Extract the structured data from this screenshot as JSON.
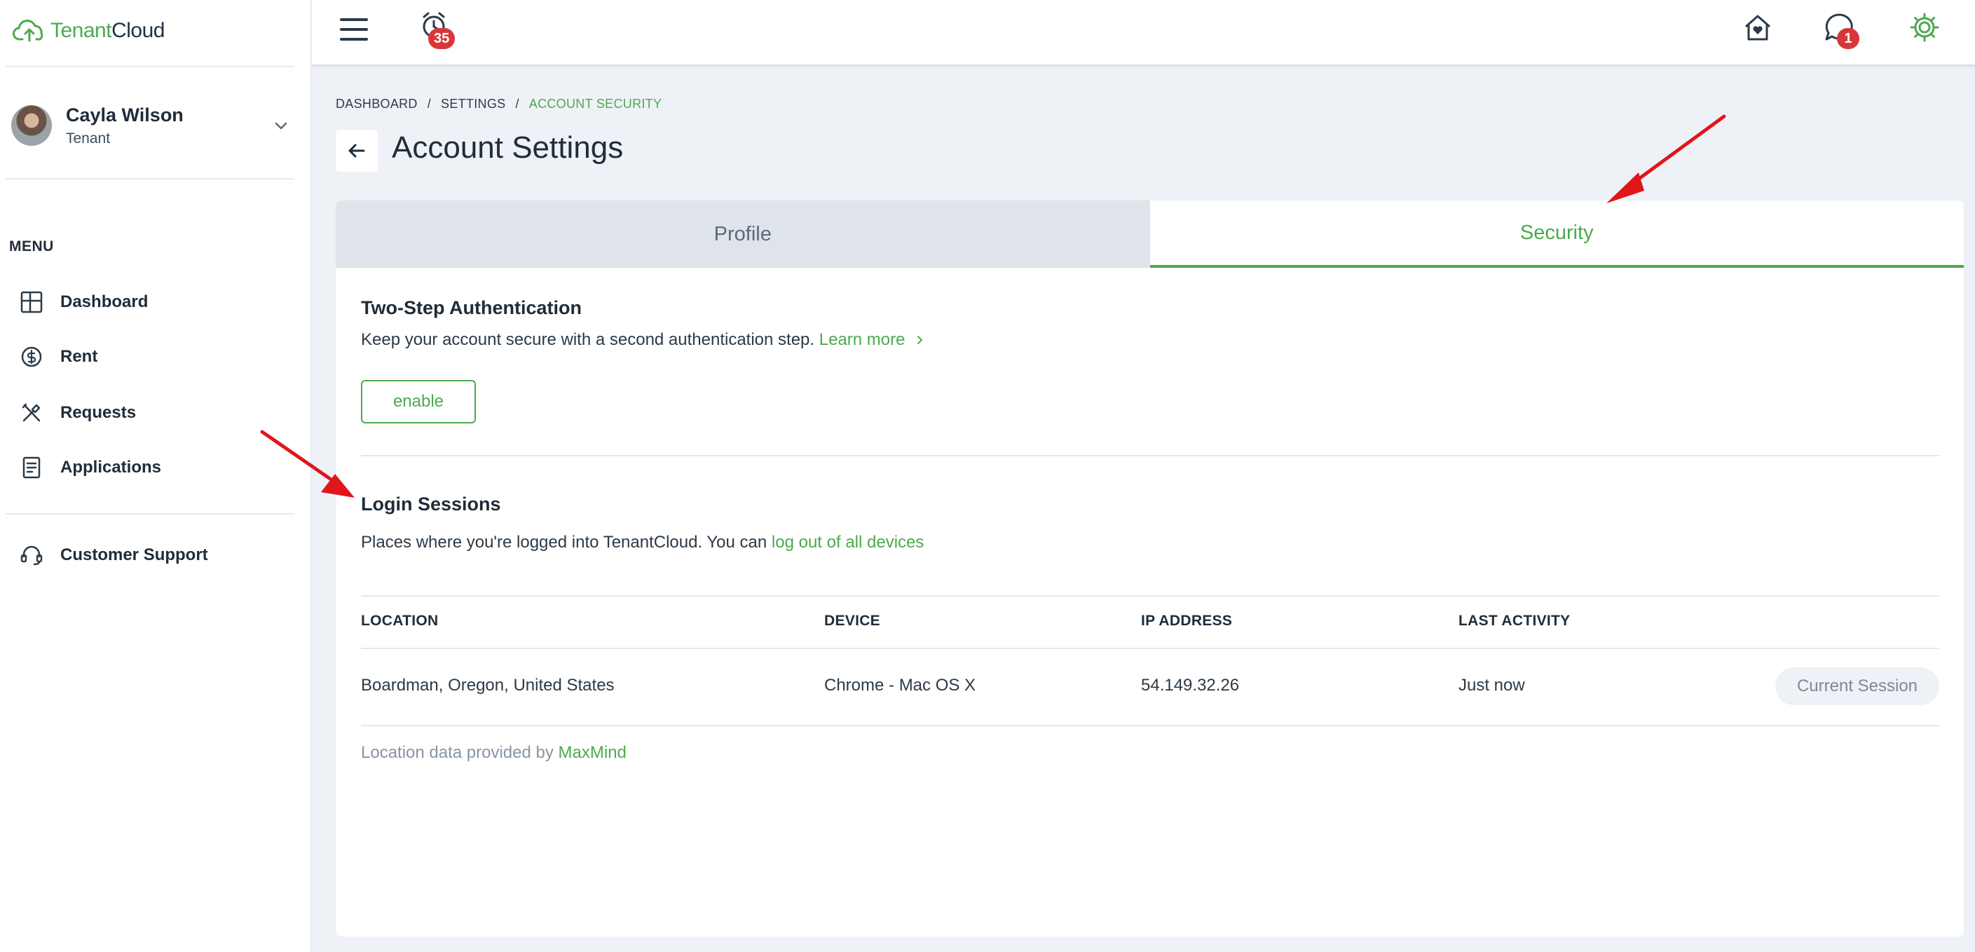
{
  "app": {
    "logo_part1": "Tenant",
    "logo_part2": "Cloud"
  },
  "user": {
    "name": "Cayla Wilson",
    "role": "Tenant"
  },
  "sidebar": {
    "menu_title": "MENU",
    "items": [
      {
        "label": "Dashboard",
        "icon": "dashboard-icon"
      },
      {
        "label": "Rent",
        "icon": "dollar-circle-icon"
      },
      {
        "label": "Requests",
        "icon": "tools-icon"
      },
      {
        "label": "Applications",
        "icon": "document-icon"
      },
      {
        "label": "Customer Support",
        "icon": "headset-icon"
      }
    ]
  },
  "topbar": {
    "notifications_count": "35",
    "messages_count": "1"
  },
  "breadcrumb": [
    "DASHBOARD",
    "SETTINGS",
    "ACCOUNT SECURITY"
  ],
  "page_title": "Account Settings",
  "tabs": {
    "profile": "Profile",
    "security": "Security",
    "active": "Security"
  },
  "two_step": {
    "title": "Two-Step Authentication",
    "description": "Keep your account secure with a second authentication step.",
    "learn_more": "Learn more",
    "enable_label": "enable"
  },
  "login_sessions": {
    "title": "Login Sessions",
    "description": "Places where you're logged into TenantCloud. You can",
    "logout_link": "log out of all devices",
    "columns": [
      "LOCATION",
      "DEVICE",
      "IP ADDRESS",
      "LAST ACTIVITY"
    ],
    "rows": [
      {
        "location": "Boardman, Oregon, United States",
        "device": "Chrome - Mac OS X",
        "ip": "54.149.32.26",
        "last_activity": "Just now",
        "status": "Current Session"
      }
    ],
    "footer_text": "Location data provided by",
    "footer_link": "MaxMind"
  },
  "colors": {
    "accent": "#4caa4f",
    "badge": "#d8373a",
    "annotation_arrow": "#e0161b"
  }
}
